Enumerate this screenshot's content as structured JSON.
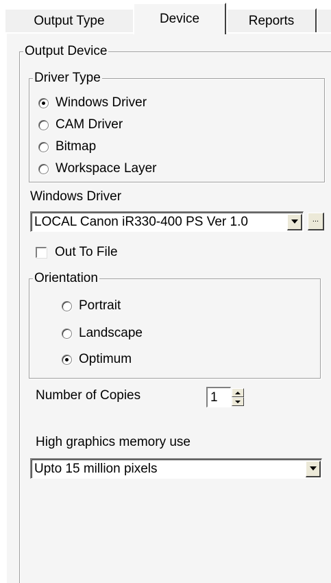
{
  "tabs": [
    {
      "label": "Output Type",
      "active": false
    },
    {
      "label": "Device",
      "active": true
    },
    {
      "label": "Reports",
      "active": false
    }
  ],
  "output_device": {
    "legend": "Output Device",
    "driver_type": {
      "legend": "Driver Type",
      "options": [
        "Windows Driver",
        "CAM Driver",
        "Bitmap",
        "Workspace Layer"
      ],
      "selected": "Windows Driver"
    },
    "windows_driver": {
      "label": "Windows Driver",
      "value": "LOCAL Canon iR330-400 PS Ver 1.0",
      "browse_label": "..."
    },
    "out_to_file": {
      "label": "Out To File",
      "checked": false
    },
    "orientation": {
      "legend": "Orientation",
      "options": [
        "Portrait",
        "Landscape",
        "Optimum"
      ],
      "selected": "Optimum"
    },
    "copies": {
      "label": "Number of Copies",
      "value": "1"
    },
    "graphics_memory": {
      "label": "High graphics memory use",
      "value": "Upto 15 million pixels"
    }
  }
}
